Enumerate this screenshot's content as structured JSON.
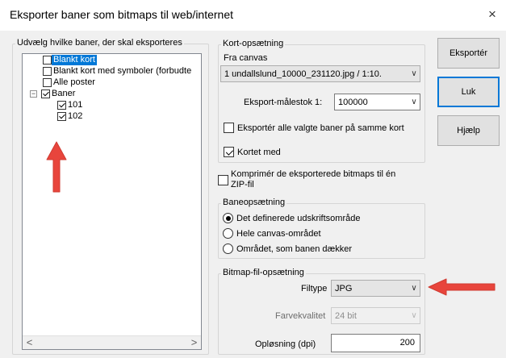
{
  "window": {
    "title": "Eksporter baner som bitmaps til web/internet",
    "close_glyph": "×"
  },
  "course_panel": {
    "legend": "Udvælg hvilke baner, der skal eksporteres",
    "tree": [
      {
        "label": "Blankt kort",
        "checked": false,
        "selected": true
      },
      {
        "label": "Blankt kort med symboler (forbudte",
        "checked": false
      },
      {
        "label": "Alle poster",
        "checked": false
      },
      {
        "label": "Baner",
        "checked": true,
        "expander": "−"
      },
      {
        "label": "101",
        "checked": true
      },
      {
        "label": "102",
        "checked": true
      }
    ],
    "scroll_left": "<",
    "scroll_right": ">"
  },
  "map_setup": {
    "legend": "Kort-opsætning",
    "from_canvas_label": "Fra canvas",
    "canvas_value": "1 undallslund_10000_231120.jpg  / 1:10.",
    "scale_label": "Eksport-målestok  1:",
    "scale_value": "100000",
    "same_map_label": "Eksportér alle valgte baner på samme kort",
    "same_map_checked": false,
    "map_with_label": "Kortet med",
    "map_with_checked": true
  },
  "zip": {
    "label_line1": "Komprimér de eksporterede bitmaps til én",
    "label_line2": "ZIP-fil",
    "checked": false
  },
  "course_setup": {
    "legend": "Baneopsætning",
    "options": [
      {
        "label": "Det definerede udskriftsområde",
        "selected": true
      },
      {
        "label": "Hele canvas-området",
        "selected": false
      },
      {
        "label": "Området, som banen dækker",
        "selected": false
      }
    ]
  },
  "bitmap_setup": {
    "legend": "Bitmap-fil-opsætning",
    "filetype_label": "Filtype",
    "filetype_value": "JPG",
    "color_quality_label": "Farvekvalitet",
    "color_quality_value": "24 bit",
    "resolution_label": "Opløsning (dpi)",
    "resolution_value": "200"
  },
  "buttons": {
    "export": "Eksportér",
    "close": "Luk",
    "help": "Hjælp"
  },
  "icons": {
    "caret": "∨"
  },
  "annotation_color": "#e8453c"
}
